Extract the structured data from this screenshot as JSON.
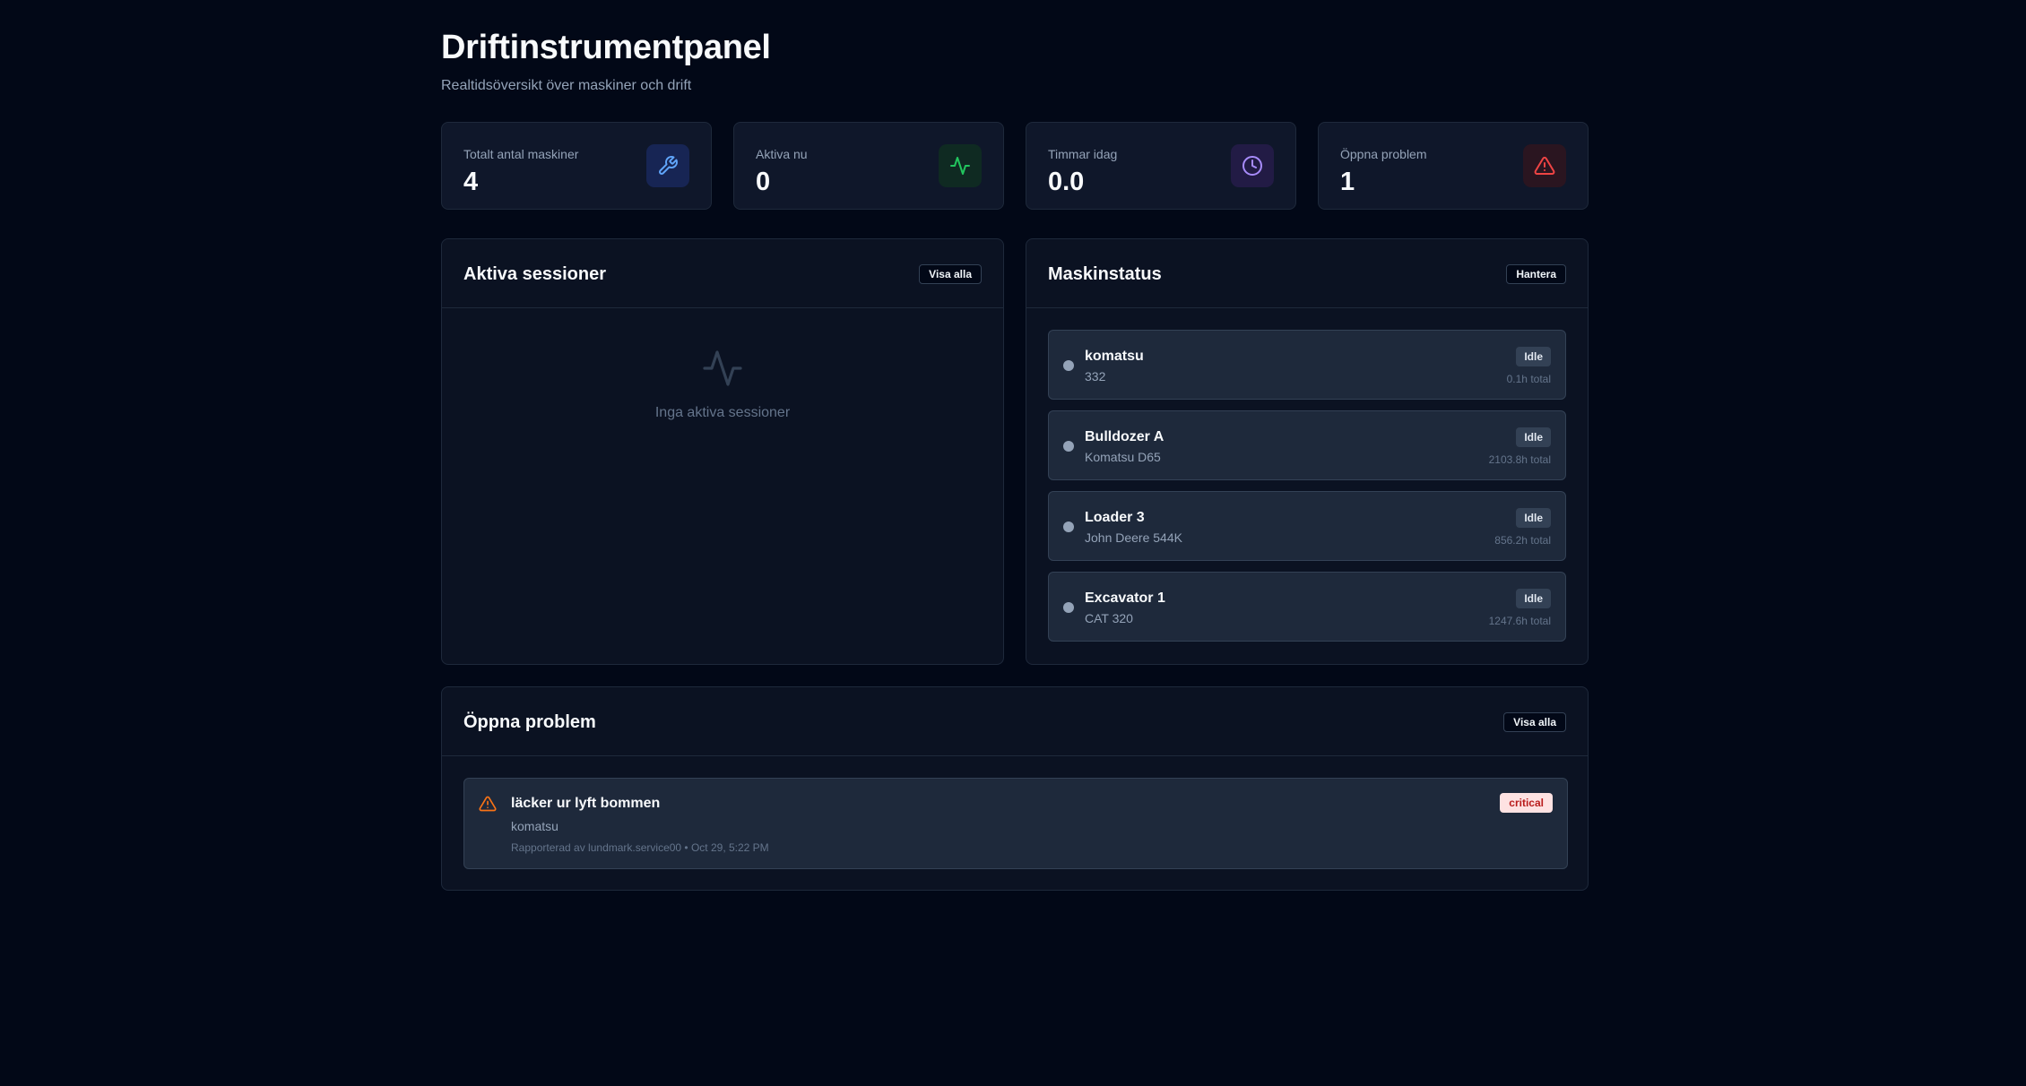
{
  "header": {
    "title": "Driftinstrumentpanel",
    "subtitle": "Realtidsöversikt över maskiner och drift"
  },
  "stats": [
    {
      "label": "Totalt antal maskiner",
      "value": "4",
      "icon": "wrench-icon",
      "color": "#60a5fa"
    },
    {
      "label": "Aktiva nu",
      "value": "0",
      "icon": "activity-icon",
      "color": "#22c55e"
    },
    {
      "label": "Timmar idag",
      "value": "0.0",
      "icon": "clock-icon",
      "color": "#a78bfa"
    },
    {
      "label": "Öppna problem",
      "value": "1",
      "icon": "alert-triangle-icon",
      "color": "#ef4444"
    }
  ],
  "sessions": {
    "title": "Aktiva sessioner",
    "button": "Visa alla",
    "empty_text": "Inga aktiva sessioner"
  },
  "machines": {
    "title": "Maskinstatus",
    "button": "Hantera",
    "items": [
      {
        "name": "komatsu",
        "model": "332",
        "status": "Idle",
        "hours": "0.1h total"
      },
      {
        "name": "Bulldozer A",
        "model": "Komatsu D65",
        "status": "Idle",
        "hours": "2103.8h total"
      },
      {
        "name": "Loader 3",
        "model": "John Deere 544K",
        "status": "Idle",
        "hours": "856.2h total"
      },
      {
        "name": "Excavator 1",
        "model": "CAT 320",
        "status": "Idle",
        "hours": "1247.6h total"
      }
    ]
  },
  "problems": {
    "title": "Öppna problem",
    "button": "Visa alla",
    "items": [
      {
        "title": "läcker ur lyft bommen",
        "machine": "komatsu",
        "reported": "Rapporterad av lundmark.service00 • Oct 29, 5:22 PM",
        "severity": "critical"
      }
    ]
  }
}
